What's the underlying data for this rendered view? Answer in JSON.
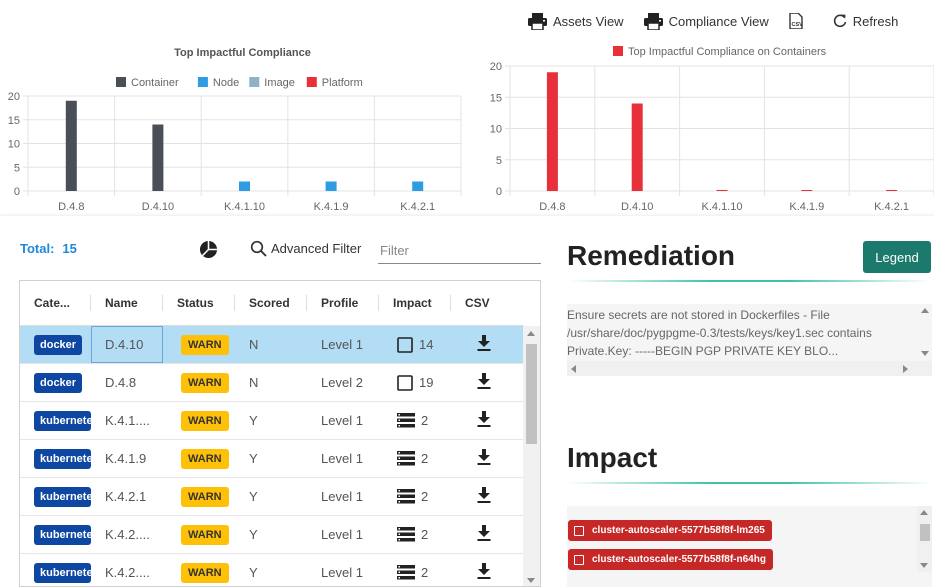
{
  "toolbar": {
    "assets_view": "Assets View",
    "compliance_view": "Compliance View",
    "refresh": "Refresh"
  },
  "colors": {
    "container": "#4a4f57",
    "node": "#2f9be3",
    "image": "#8fb2c9",
    "platform": "#e8303a",
    "accent": "#1e88d9",
    "legend_button": "#1b7a6c",
    "warn": "#ffc107",
    "category_badge": "#0d47a1",
    "pod_badge": "#c62828"
  },
  "chart_data": [
    {
      "type": "bar",
      "title": "Top Impactful Compliance",
      "categories": [
        "D.4.8",
        "D.4.10",
        "K.4.1.10",
        "K.4.1.9",
        "K.4.2.1"
      ],
      "series": [
        {
          "name": "Container",
          "values": [
            19,
            14,
            0,
            0,
            0
          ]
        },
        {
          "name": "Node",
          "values": [
            0,
            0,
            2,
            2,
            2
          ]
        },
        {
          "name": "Image",
          "values": [
            0,
            0,
            0,
            0,
            0
          ]
        },
        {
          "name": "Platform",
          "values": [
            0,
            0,
            0,
            0,
            0
          ]
        }
      ],
      "yticks": [
        0,
        5,
        10,
        15,
        20
      ],
      "ylim": [
        0,
        20
      ],
      "grid": true,
      "legend_position": "top"
    },
    {
      "type": "bar",
      "title": "",
      "categories": [
        "D.4.8",
        "D.4.10",
        "K.4.1.10",
        "K.4.1.9",
        "K.4.2.1"
      ],
      "series": [
        {
          "name": "Top Impactful Compliance on Containers",
          "values": [
            19,
            14,
            0,
            0,
            0
          ]
        }
      ],
      "yticks": [
        0,
        5,
        10,
        15,
        20
      ],
      "ylim": [
        0,
        20
      ],
      "grid": true,
      "legend_position": "top"
    }
  ],
  "summary": {
    "total_label": "Total:",
    "total_value": "15"
  },
  "filters": {
    "advanced_filter": "Advanced Filter",
    "filter_placeholder": "Filter"
  },
  "table": {
    "headers": [
      "Cate...",
      "Name",
      "Status",
      "Scored",
      "Profile",
      "Impact",
      "CSV"
    ],
    "rows": [
      {
        "category": "docker",
        "name": "D.4.10",
        "status": "WARN",
        "scored": "N",
        "profile": "Level 1",
        "impact_icon": "square-icon",
        "impact": "14"
      },
      {
        "category": "docker",
        "name": "D.4.8",
        "status": "WARN",
        "scored": "N",
        "profile": "Level 2",
        "impact_icon": "square-icon",
        "impact": "19"
      },
      {
        "category": "kubernetes",
        "name": "K.4.1....",
        "status": "WARN",
        "scored": "Y",
        "profile": "Level 1",
        "impact_icon": "stack-icon",
        "impact": "2"
      },
      {
        "category": "kubernetes",
        "name": "K.4.1.9",
        "status": "WARN",
        "scored": "Y",
        "profile": "Level 1",
        "impact_icon": "stack-icon",
        "impact": "2"
      },
      {
        "category": "kubernetes",
        "name": "K.4.2.1",
        "status": "WARN",
        "scored": "Y",
        "profile": "Level 1",
        "impact_icon": "stack-icon",
        "impact": "2"
      },
      {
        "category": "kubernetes",
        "name": "K.4.2....",
        "status": "WARN",
        "scored": "Y",
        "profile": "Level 1",
        "impact_icon": "stack-icon",
        "impact": "2"
      },
      {
        "category": "kubernetes",
        "name": "K.4.2....",
        "status": "WARN",
        "scored": "Y",
        "profile": "Level 1",
        "impact_icon": "stack-icon",
        "impact": "2"
      }
    ]
  },
  "remediation": {
    "title": "Remediation",
    "legend_button": "Legend",
    "text": "Ensure secrets are not stored in Dockerfiles - File /usr/share/doc/pygpgme-0.3/tests/keys/key1.sec contains Private.Key: -----BEGIN PGP PRIVATE KEY BLO..."
  },
  "impact": {
    "title": "Impact",
    "pods": [
      "cluster-autoscaler-5577b58f8f-lm265",
      "cluster-autoscaler-5577b58f8f-n64hg"
    ]
  }
}
